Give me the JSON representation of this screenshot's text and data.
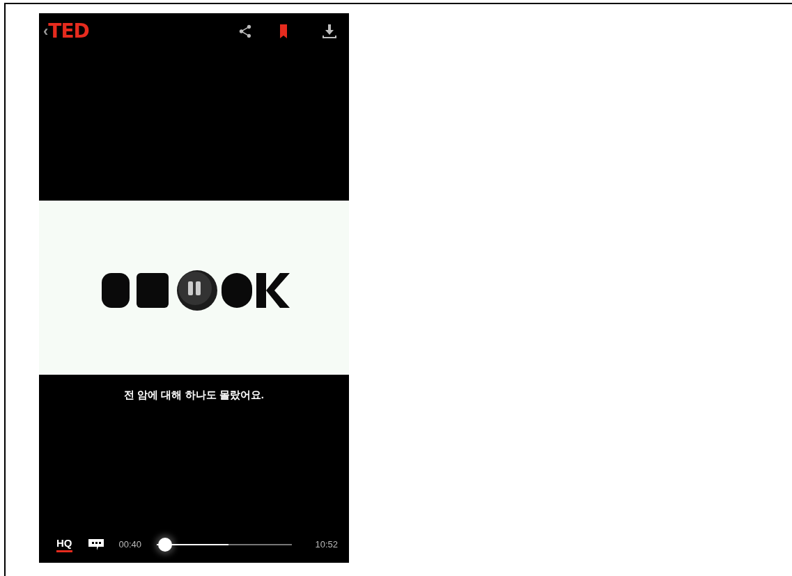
{
  "header": {
    "back": "‹",
    "logo": "TED",
    "bookmarked": true
  },
  "video": {
    "kind": "picture",
    "subtitle": "전 암에 대해 하나도 몰랐어요."
  },
  "controls": {
    "hq": {
      "label": "HQ",
      "selected": true
    },
    "elapsed": "00:40",
    "progress": {
      "level": 0.06
    },
    "buffered": {
      "level": 0.53
    },
    "duration": "10:52"
  }
}
